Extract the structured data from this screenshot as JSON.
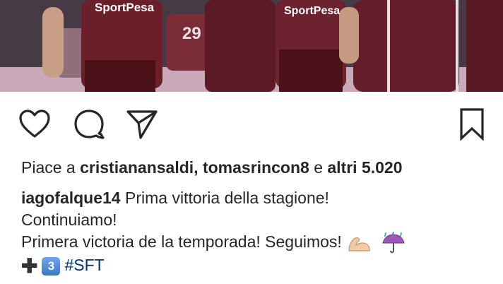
{
  "post": {
    "photo": {
      "jersey_sponsor_left": "SportPesa",
      "jersey_sponsor_right": "SportPesa",
      "jersey_number": "29"
    },
    "actions": {
      "like": "heart-icon",
      "comment": "comment-icon",
      "share": "send-icon",
      "save": "bookmark-icon"
    },
    "likes": {
      "prefix": "Piace a",
      "user1": "cristianansaldi,",
      "user2": "tomasrincon8",
      "joiner": "e",
      "others": "altri 5.020"
    },
    "caption": {
      "username": "iagofalque14",
      "line1_text": "Prima vittoria della stagione!",
      "line2": "Continuiamo!",
      "line3": "Primera victoria de la temporada! Seguimos!",
      "line4_keycap": "3",
      "line4_plus": "✚",
      "hashtag": "#SFT"
    }
  },
  "colors": {
    "text": "#262626",
    "hashtag": "#003569",
    "jersey": "#6a1f2b"
  }
}
